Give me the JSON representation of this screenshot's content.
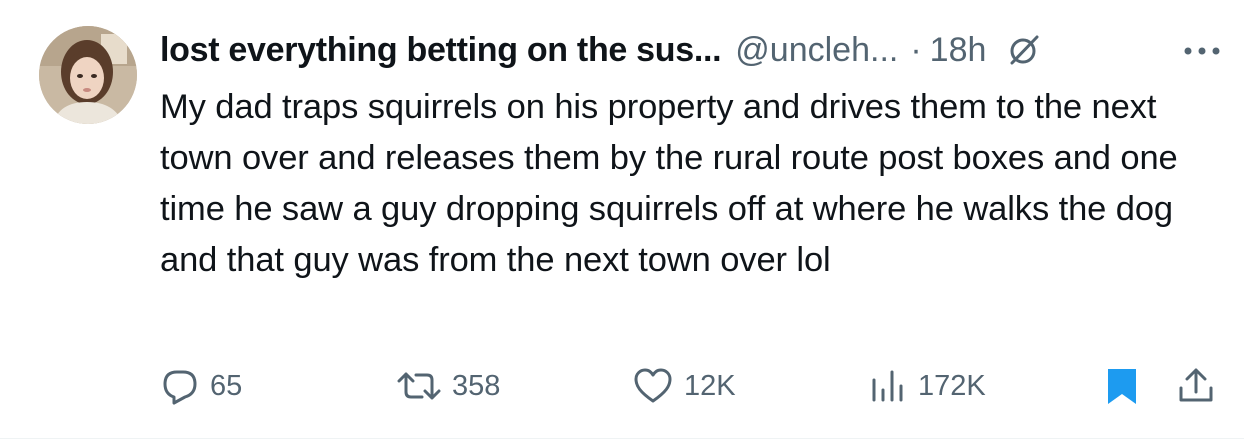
{
  "tweet": {
    "author_name": "lost everything betting on the sus...",
    "handle": "@uncleh...",
    "separator": "·",
    "time": "18h",
    "text": "My dad traps squirrels on his property and drives them to the next town over and releases them by the rural route post boxes and one time he saw a guy dropping squirrels off at where he walks the dog and that guy was from the next town over lol"
  },
  "actions": {
    "replies": "65",
    "reposts": "358",
    "likes": "12K",
    "views": "172K"
  },
  "colors": {
    "text": "#0f1419",
    "secondary": "#536471",
    "bookmark": "#1d9bf0"
  },
  "icons": [
    "grok-icon",
    "more-icon",
    "reply-icon",
    "repost-icon",
    "like-icon",
    "views-icon",
    "bookmark-icon",
    "share-icon"
  ]
}
